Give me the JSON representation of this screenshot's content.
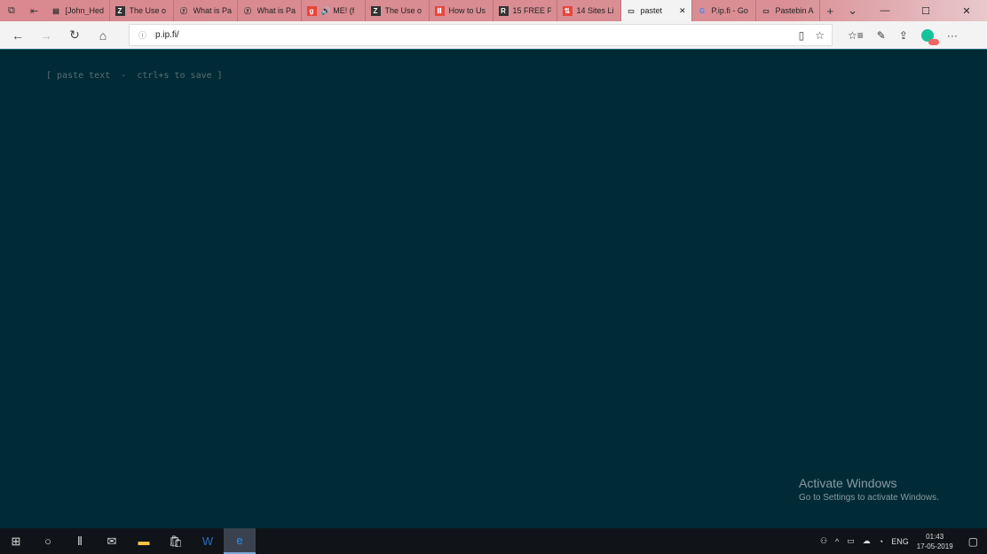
{
  "tabs": [
    {
      "label": "[John_Hed",
      "icon": "pdf-icon",
      "fav": "▤"
    },
    {
      "label": "The Use o",
      "icon": "z-icon",
      "fav": "Z"
    },
    {
      "label": "What is Pa",
      "icon": "y-icon",
      "fav": "ⓨ"
    },
    {
      "label": "What is Pa",
      "icon": "y-icon",
      "fav": "ⓨ"
    },
    {
      "label": "🔊 ME! (f",
      "icon": "g-icon",
      "fav": "g"
    },
    {
      "label": "The Use o",
      "icon": "z-icon",
      "fav": "Z"
    },
    {
      "label": "How to Us",
      "icon": "m-icon",
      "fav": "Ⅲ"
    },
    {
      "label": "15 FREE Pa",
      "icon": "r-icon",
      "fav": "R"
    },
    {
      "label": "14 Sites Li",
      "icon": "sites-icon",
      "fav": "⇅"
    },
    {
      "label": "pastet",
      "icon": "page-icon",
      "fav": "▭",
      "active": true
    },
    {
      "label": "P.ip.fi - Go",
      "icon": "google-icon",
      "fav": "G"
    },
    {
      "label": "Pastebin A",
      "icon": "page-icon",
      "fav": "▭"
    }
  ],
  "address": {
    "url": "p.ip.fi/"
  },
  "page": {
    "hint": "[ paste text  -  ctrl+s to save ]"
  },
  "watermark": {
    "title": "Activate Windows",
    "subtitle": "Go to Settings to activate Windows."
  },
  "tray": {
    "lang": "ENG",
    "time": "01:43",
    "date": "17-05-2019"
  },
  "colors": {
    "background": "#002b36",
    "hint": "#586e75",
    "tabbar": "#d9898f"
  }
}
